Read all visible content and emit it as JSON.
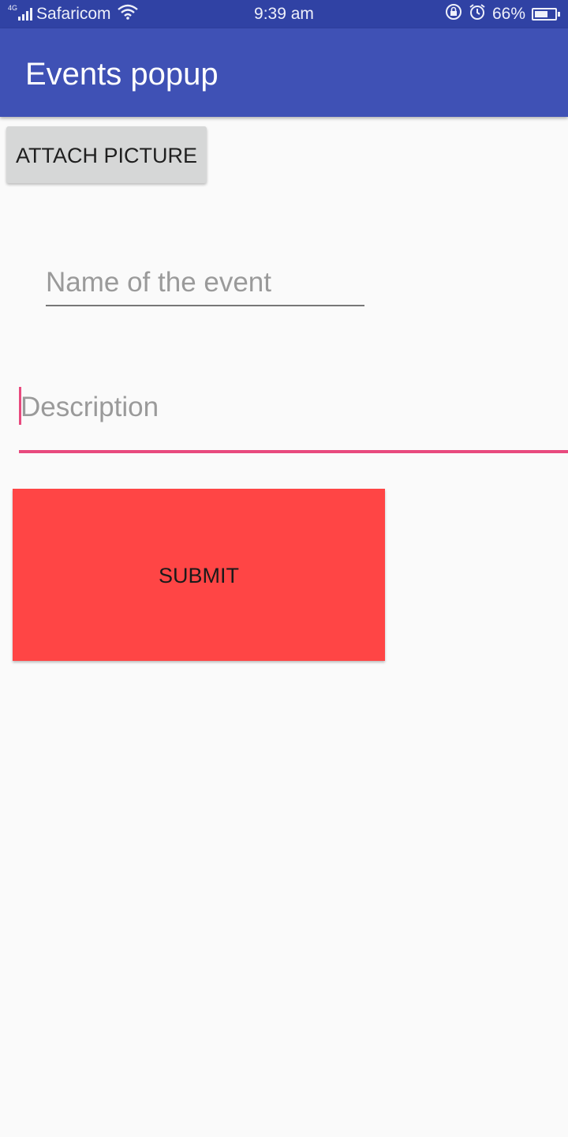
{
  "status_bar": {
    "network_type": "4G",
    "carrier": "Safaricom",
    "time": "9:39 am",
    "battery_percent": "66%",
    "battery_level": 0.66,
    "icons": [
      "signal-icon",
      "wifi-icon",
      "rotation-lock-icon",
      "alarm-icon",
      "battery-icon"
    ]
  },
  "app_bar": {
    "title": "Events popup",
    "color": "#3f51b5"
  },
  "form": {
    "attach_button_label": "ATTACH PICTURE",
    "name_field": {
      "value": "",
      "placeholder": "Name of the event"
    },
    "description_field": {
      "value": "",
      "placeholder": "Description",
      "focused": true,
      "accent_color": "#e84a7e"
    },
    "submit_button_label": "SUBMIT",
    "submit_button_color": "#ff4545"
  }
}
